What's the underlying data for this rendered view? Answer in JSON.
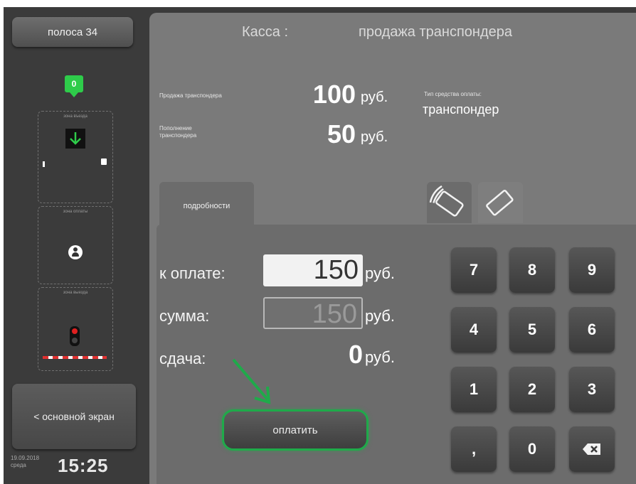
{
  "sidebar": {
    "lane_label": "полоса 34",
    "entry_badge": "0",
    "entry_zone_label": "зона въезда",
    "pay_zone_label": "зона оплаты",
    "exit_zone_label": "зона выезда",
    "home_button": "< основной экран",
    "date": "19.09.2018",
    "day": "среда",
    "time": "15:25"
  },
  "header": {
    "title_left": "Касса :",
    "title_right": "продажа транспондера"
  },
  "summary": {
    "sale_label": "Продажа транспондера",
    "sale_amount": "100",
    "topup_label_line1": "Пополнение",
    "topup_label_line2": "транспондера",
    "topup_amount": "50",
    "currency": "руб.",
    "payment_type_label": "Тип средства оплаты:",
    "payment_type_value": "транспондер"
  },
  "tabs": {
    "details_label": "подробности",
    "icons": [
      "card-reader-icon",
      "transponder-icon"
    ]
  },
  "payment": {
    "due_label": "к оплате:",
    "due_value": "150",
    "sum_label": "сумма:",
    "sum_value": "150",
    "change_label": "сдача:",
    "change_value": "0",
    "currency": "руб.",
    "pay_button": "оплатить"
  },
  "keypad": {
    "keys": [
      "7",
      "8",
      "9",
      "4",
      "5",
      "6",
      "1",
      "2",
      "3",
      ",",
      "0"
    ],
    "backspace_icon": "backspace-icon"
  },
  "colors": {
    "accent_green": "#1faa4a",
    "panel": "#7a7a7a",
    "background": "#3b3b3b"
  }
}
